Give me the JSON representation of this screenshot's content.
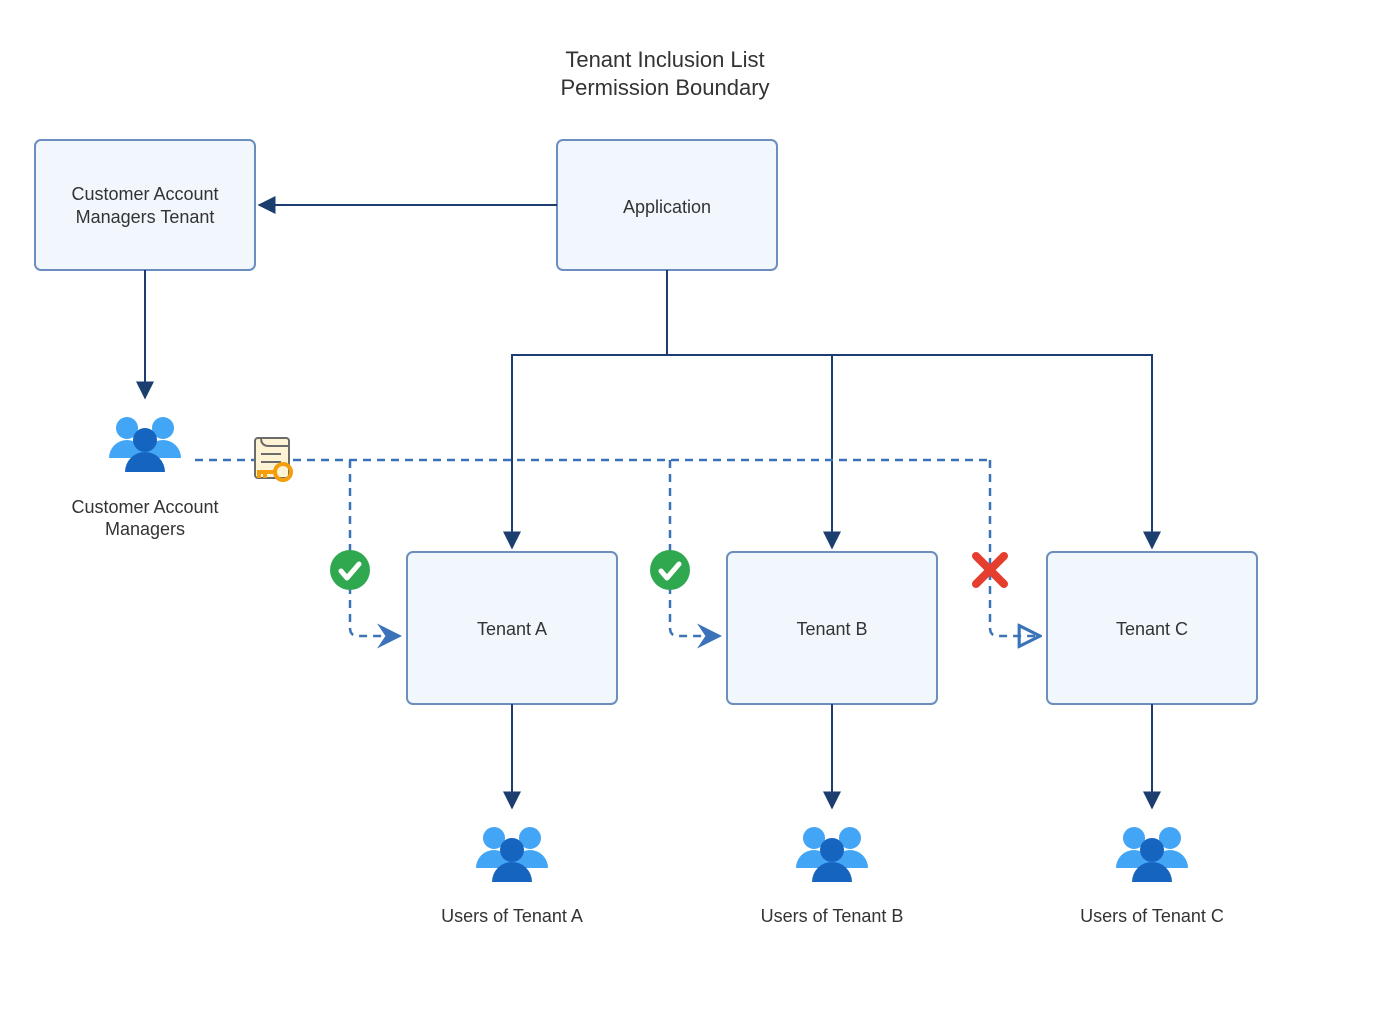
{
  "title": {
    "line1": "Tenant Inclusion List",
    "line2": "Permission Boundary"
  },
  "nodes": {
    "cam_tenant": {
      "line1": "Customer Account",
      "line2": "Managers Tenant"
    },
    "application": "Application",
    "tenant_a": "Tenant A",
    "tenant_b": "Tenant B",
    "tenant_c": "Tenant C"
  },
  "labels": {
    "cam_users": {
      "line1": "Customer Account",
      "line2": "Managers"
    },
    "users_a": "Users of Tenant A",
    "users_b": "Users of Tenant B",
    "users_c": "Users of Tenant C"
  },
  "icons": {
    "cam_users": "people-icon",
    "key_doc": "key-document-icon",
    "check_a": "check-icon",
    "check_b": "check-icon",
    "cross_c": "cross-icon",
    "users_a": "people-icon",
    "users_b": "people-icon",
    "users_c": "people-icon"
  },
  "permissions": {
    "tenant_a": "allowed",
    "tenant_b": "allowed",
    "tenant_c": "denied"
  },
  "colors": {
    "box_fill": "#f2f7fe",
    "box_stroke": "#6c8ebf",
    "arrow": "#1c3e6e",
    "dash": "#3b73b9",
    "check_bg": "#2fa84f",
    "cross": "#e63e2e",
    "people_dark": "#1565c0",
    "people_light": "#42a5f5",
    "key": "#f59e0b",
    "doc": "#fff3d6"
  }
}
